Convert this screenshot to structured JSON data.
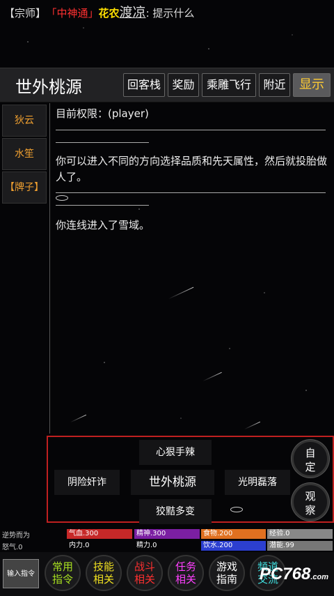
{
  "topline": {
    "sect": "【宗师】",
    "title_tag": "「中神通」",
    "name": "花农",
    "alias": "渡凉",
    "hint": ": 提示什么"
  },
  "header": {
    "location": "世外桃源",
    "buttons": [
      "回客栈",
      "奖励",
      "乘雕飞行",
      "附近",
      "显示"
    ]
  },
  "sidebar": {
    "items": [
      {
        "label": "狄云"
      },
      {
        "label": "水笙"
      },
      {
        "label": "【牌子】"
      }
    ]
  },
  "messages": {
    "permission": "目前权限：(player)",
    "intro": "你可以进入不同的方向选择品质和先天属性，然后就投胎做人了。",
    "connect": "你连线进入了雪域。"
  },
  "panel": {
    "north": "心狠手辣",
    "west": "阴险奸诈",
    "center": "世外桃源",
    "east": "光明磊落",
    "south": "狡黠多变",
    "custom": "自定",
    "observe": "观察"
  },
  "stats": {
    "row1_label": "逆势而为",
    "row2_label": "怒气.0",
    "hp": "气血.300",
    "spirit": "精神.300",
    "food": "食物.200",
    "exp": "经验.0",
    "neili": "内力.0",
    "jingli": "精力.0",
    "water": "饮水.200",
    "potential": "潜能.99",
    "colors": {
      "hp": "#c62828",
      "spirit": "#7b1fa2",
      "food": "#e07020",
      "exp": "#888888",
      "water": "#2c3fd0"
    }
  },
  "bottom_nav": {
    "input": "输入指令",
    "items": [
      {
        "line1": "常用",
        "line2": "指令",
        "color": "#a8e020"
      },
      {
        "line1": "技能",
        "line2": "相关",
        "color": "#f0e020"
      },
      {
        "line1": "战斗",
        "line2": "相关",
        "color": "#ff3030"
      },
      {
        "line1": "任务",
        "line2": "相关",
        "color": "#ff40ff"
      },
      {
        "line1": "游戏",
        "line2": "指南",
        "color": "#ffffff"
      },
      {
        "line1": "频道",
        "line2": "交流",
        "color": "#40e0e0"
      }
    ],
    "watermark": "PC768",
    "watermark_sub": ".com"
  }
}
